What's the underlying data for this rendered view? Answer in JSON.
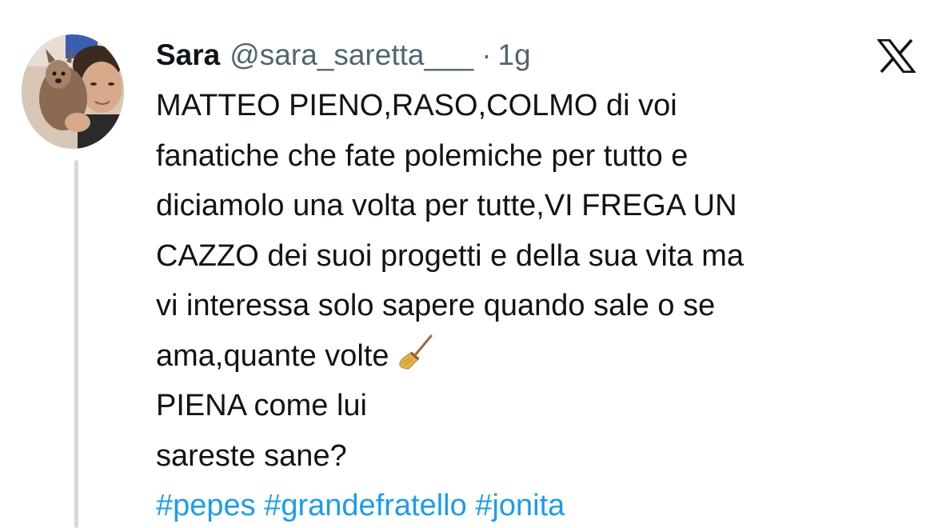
{
  "author": {
    "display_name": "Sara",
    "handle": "@sara_saretta___",
    "separator": "·",
    "time": "1g",
    "avatar_icon": "profile-photo-person-holding-dog"
  },
  "brand": {
    "logo_icon": "x-logo-icon"
  },
  "tweet": {
    "lines": [
      "MATTEO PIENO,RASO,COLMO di voi",
      "fanatiche che fate polemiche per tutto e",
      "diciamolo una volta per tutte,VI FREGA UN",
      "CAZZO dei suoi progetti e della sua vita ma",
      "vi interessa solo sapere quando sale o se",
      "ama,quante volte",
      "PIENA come lui",
      "sareste sane?"
    ],
    "emoji_icon": "broom-emoji",
    "hashtags": [
      "#pepes",
      "#grandefratello",
      "#jonita"
    ]
  },
  "colors": {
    "text": "#0f1419",
    "secondary": "#536471",
    "link": "#1d9bf0",
    "thread_line": "#cfd9de"
  }
}
